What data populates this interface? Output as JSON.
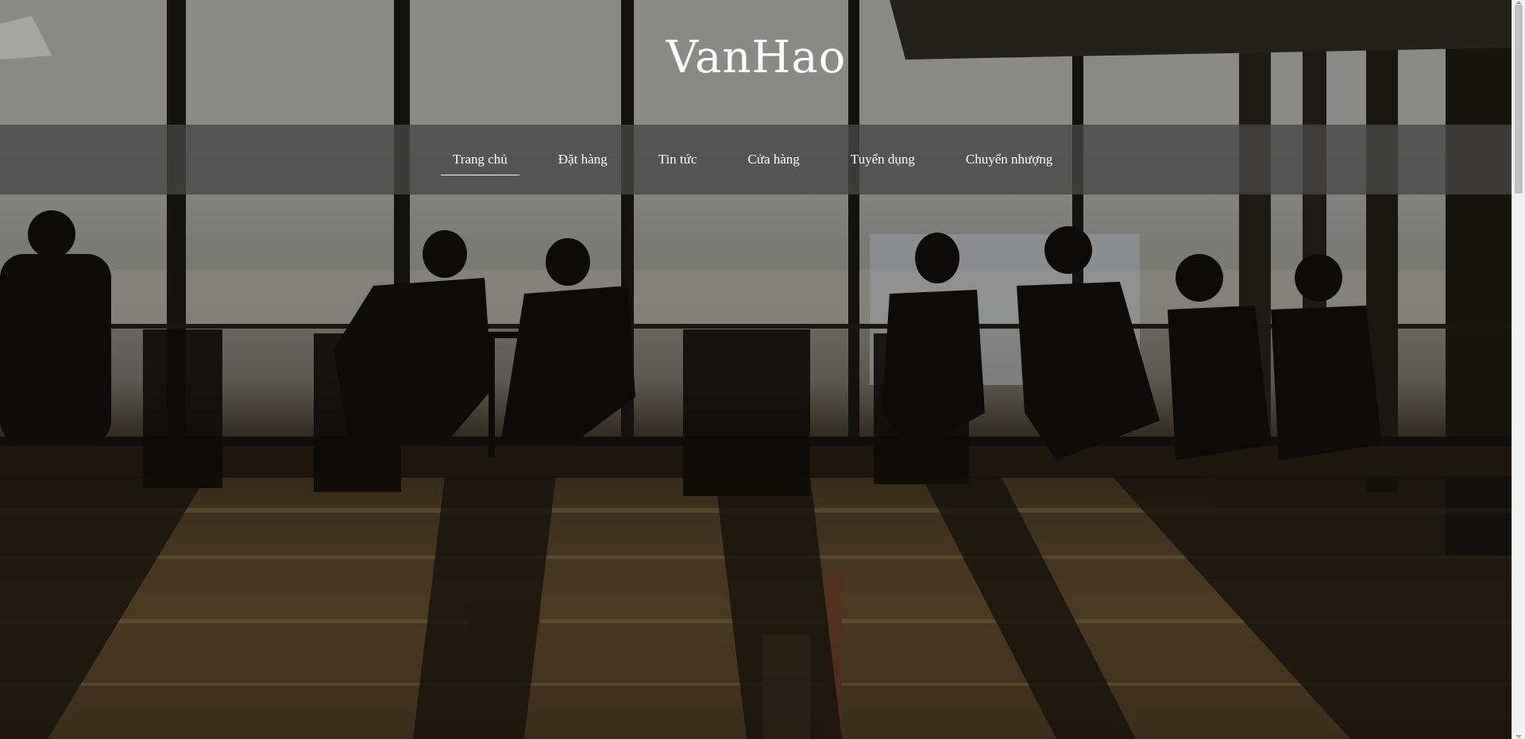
{
  "site": {
    "brand": "VanHao"
  },
  "nav": {
    "items": [
      {
        "label": "Trang chủ",
        "active": true
      },
      {
        "label": "Đặt hàng",
        "active": false
      },
      {
        "label": "Tin tức",
        "active": false
      },
      {
        "label": "Cửa hàng",
        "active": false
      },
      {
        "label": "Tuyển dụng",
        "active": false
      },
      {
        "label": "Chuyển nhượng",
        "active": false
      }
    ]
  },
  "hero": {
    "image": "airport-cafe-silhouettes-photo"
  },
  "colors": {
    "nav_background": "#464646",
    "text": "#ffffff"
  }
}
